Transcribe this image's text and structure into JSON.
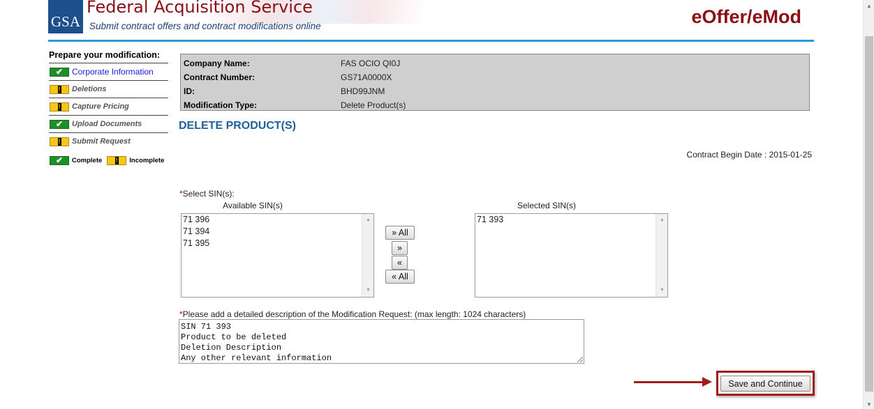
{
  "header": {
    "logo_text": "GSA",
    "title": "Federal Acquisition Service",
    "tagline": "Submit contract offers and contract modifications online",
    "brand": "eOffer/eMod"
  },
  "sidebar": {
    "title": "Prepare your modification:",
    "steps": [
      {
        "label": "Corporate Information",
        "status": "complete"
      },
      {
        "label": "Deletions",
        "status": "incomplete"
      },
      {
        "label": "Capture Pricing",
        "status": "incomplete"
      },
      {
        "label": "Upload Documents",
        "status": "complete"
      },
      {
        "label": "Submit Request",
        "status": "incomplete"
      }
    ],
    "legend": {
      "complete": "Complete",
      "incomplete": "Incomplete"
    }
  },
  "info": {
    "company_label": "Company Name:",
    "company_value": "FAS OCIO QI0J",
    "contract_label": "Contract Number:",
    "contract_value": "GS71A0000X",
    "id_label": "ID:",
    "id_value": "BHD99JNM",
    "modtype_label": "Modification Type:",
    "modtype_value": "Delete Product(s)"
  },
  "main": {
    "section_title": "DELETE PRODUCT(S)",
    "begin_date": "Contract Begin Date : 2015-01-25",
    "sin_label": "Select SIN(s):",
    "available_heading": "Available SIN(s)",
    "selected_heading": "Selected SIN(s)",
    "available": [
      "71 396",
      "71 394",
      "71 395"
    ],
    "selected": [
      "71 393"
    ],
    "buttons": {
      "move_all_right": "» All",
      "move_right": "»",
      "move_left": "«",
      "move_all_left": "« All"
    },
    "desc_label": "Please add a detailed description of the Modification Request: (max length: 1024 characters)",
    "desc_value": "SIN 71 393\nProduct to be deleted\nDeletion Description\nAny other relevant information",
    "required_mark": "*",
    "save_label": "Save and Continue"
  },
  "colors": {
    "brand_red": "#8b0f14",
    "header_rule": "#2e9ad0",
    "section_title": "#1f5f9a",
    "complete_green": "#1f8f2a",
    "incomplete_yellow": "#f5c518",
    "annotation_red": "#a31b1b"
  }
}
